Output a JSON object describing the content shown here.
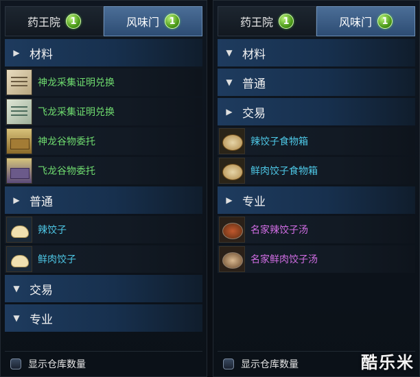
{
  "left": {
    "tabs": [
      {
        "label": "药王院",
        "badge": "1"
      },
      {
        "label": "风味门",
        "badge": "1"
      }
    ],
    "categories": [
      {
        "label": "材料",
        "items": [
          {
            "label": "神龙采集证明兑换",
            "icon": "scroll-icon"
          },
          {
            "label": "飞龙采集证明兑换",
            "icon": "scroll-icon"
          },
          {
            "label": "神龙谷物委托",
            "icon": "grain-box-icon"
          },
          {
            "label": "飞龙谷物委托",
            "icon": "grain-box-icon"
          }
        ]
      },
      {
        "label": "普通",
        "items": [
          {
            "label": "辣饺子",
            "icon": "dumpling-icon"
          },
          {
            "label": "鲜肉饺子",
            "icon": "dumpling-icon"
          }
        ]
      },
      {
        "label": "交易"
      },
      {
        "label": "专业"
      }
    ],
    "footer_label": "显示仓库数量"
  },
  "right": {
    "tabs": [
      {
        "label": "药王院",
        "badge": "1"
      },
      {
        "label": "风味门",
        "badge": "1"
      }
    ],
    "categories": [
      {
        "label": "材料"
      },
      {
        "label": "普通"
      },
      {
        "label": "交易",
        "items": [
          {
            "label": "辣饺子食物箱",
            "icon": "steamer-icon"
          },
          {
            "label": "鲜肉饺子食物箱",
            "icon": "steamer-icon"
          }
        ]
      },
      {
        "label": "专业",
        "items": [
          {
            "label": "名家辣饺子汤",
            "icon": "soup-bowl-icon"
          },
          {
            "label": "名家鲜肉饺子汤",
            "icon": "soup-bowl-icon"
          }
        ]
      }
    ],
    "footer_label": "显示仓库数量"
  },
  "watermark": "酷乐米",
  "colors": {
    "active_tab": "#3b5c84",
    "category_bar": "#1e3b5e",
    "material_text": "#6fdc6f",
    "common_text": "#4ec9e8",
    "pro_text": "#d36ee6",
    "badge": "#5bb82a"
  },
  "icons": {
    "collapsed": "triangle-right-icon",
    "expanded": "triangle-down-icon"
  }
}
